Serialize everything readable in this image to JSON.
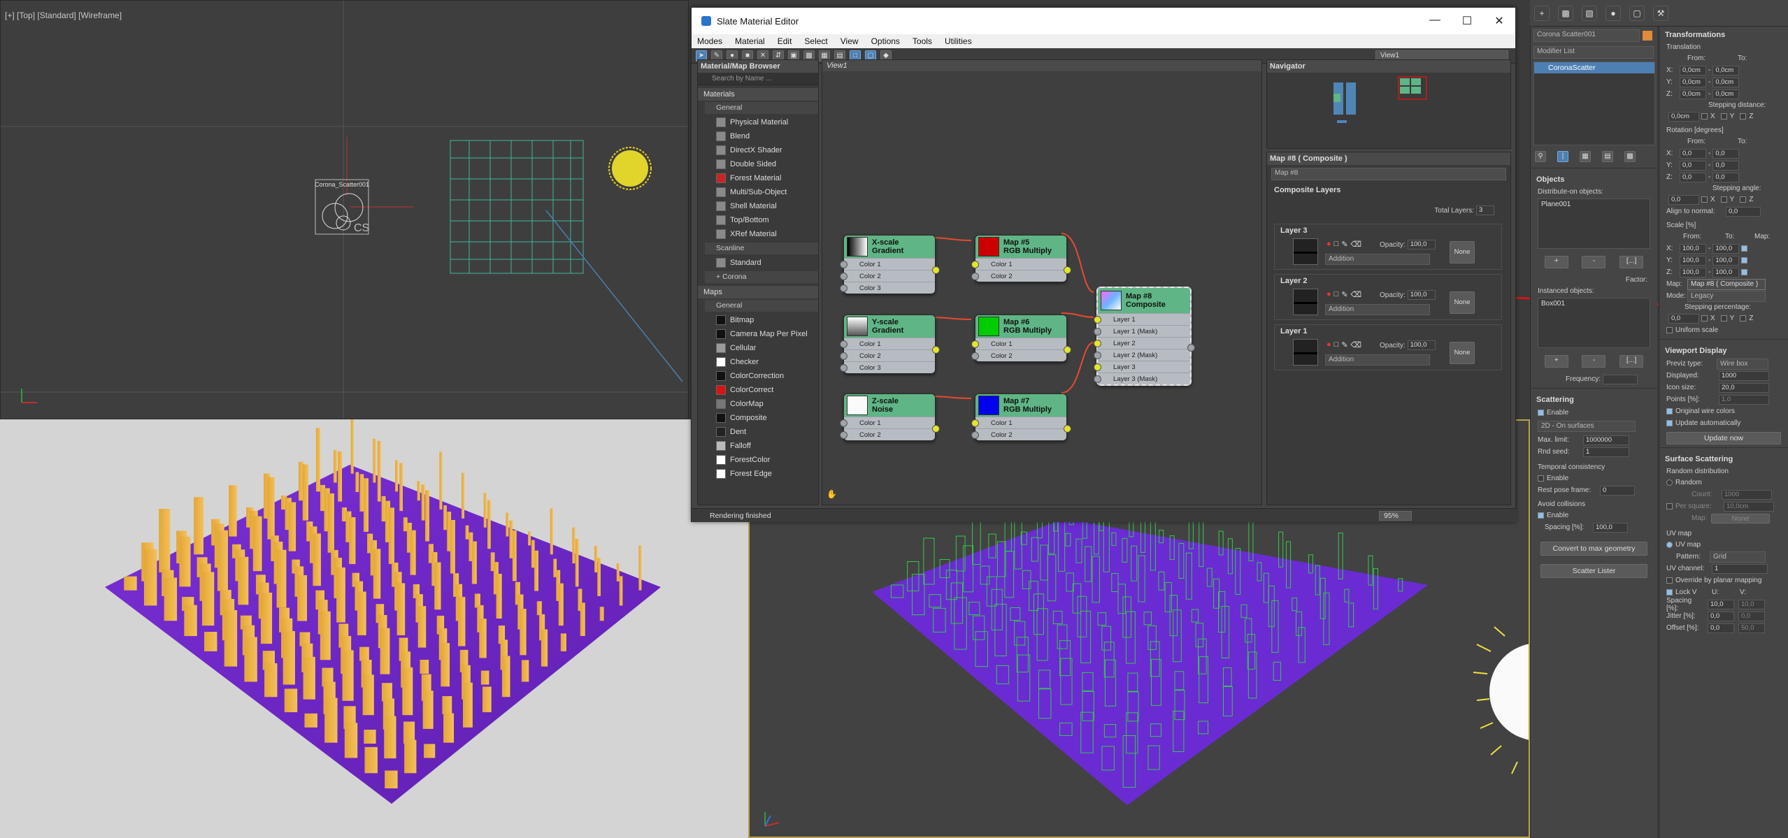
{
  "viewports": {
    "top_label": "[+] [Top] [Standard] [Wireframe]",
    "scatter_label": "Corona_Scatter001",
    "scatter_marker": "CS"
  },
  "slate": {
    "title": "Slate Material Editor",
    "menu": [
      "Modes",
      "Material",
      "Edit",
      "Select",
      "View",
      "Options",
      "Tools",
      "Utilities"
    ],
    "view_select": "View1",
    "view_tab": "View1",
    "browser": {
      "title": "Material/Map Browser",
      "search_placeholder": "Search by Name ...",
      "materials_group": "Materials",
      "general_sub": "General",
      "materials": [
        {
          "name": "Physical Material",
          "swatch": "#8a8a8a"
        },
        {
          "name": "Blend",
          "swatch": "#8a8a8a"
        },
        {
          "name": "DirectX Shader",
          "swatch": "#8a8a8a"
        },
        {
          "name": "Double Sided",
          "swatch": "#8a8a8a"
        },
        {
          "name": "Forest Material",
          "swatch": "#cc2222"
        },
        {
          "name": "Multi/Sub-Object",
          "swatch": "#8a8a8a"
        },
        {
          "name": "Shell Material",
          "swatch": "#8a8a8a"
        },
        {
          "name": "Top/Bottom",
          "swatch": "#8a8a8a"
        },
        {
          "name": "XRef Material",
          "swatch": "#8a8a8a"
        }
      ],
      "scanline_sub": "Scanline",
      "scanline_items": [
        {
          "name": "Standard",
          "swatch": "#8a8a8a"
        }
      ],
      "corona_sub": "+ Corona",
      "maps_group": "Maps",
      "maps_general_sub": "General",
      "maps": [
        {
          "name": "Bitmap",
          "swatch": "#111111"
        },
        {
          "name": "Camera Map Per Pixel",
          "swatch": "#111111"
        },
        {
          "name": "Cellular",
          "swatch": "#9a9a9a"
        },
        {
          "name": "Checker",
          "swatch": "#ffffff"
        },
        {
          "name": "ColorCorrection",
          "swatch": "#111111"
        },
        {
          "name": "ColorCorrect",
          "swatch": "#dd1111"
        },
        {
          "name": "ColorMap",
          "swatch": "#777777"
        },
        {
          "name": "Composite",
          "swatch": "#111111"
        },
        {
          "name": "Dent",
          "swatch": "#222222"
        },
        {
          "name": "Falloff",
          "swatch": "#bbbbbb"
        },
        {
          "name": "ForestColor",
          "swatch": "#ffffff"
        },
        {
          "name": "Forest Edge",
          "swatch": "#ffffff"
        }
      ]
    },
    "nodes": {
      "x_gradient": {
        "title1": "X-scale",
        "title2": "Gradient",
        "slots": [
          "Color 1",
          "Color 2",
          "Color 3"
        ]
      },
      "y_gradient": {
        "title1": "Y-scale",
        "title2": "Gradient",
        "slots": [
          "Color 1",
          "Color 2",
          "Color 3"
        ]
      },
      "z_noise": {
        "title1": "Z-scale",
        "title2": "Noise",
        "slots": [
          "Color 1",
          "Color 2"
        ]
      },
      "map5": {
        "title1": "Map #5",
        "title2": "RGB Multiply",
        "slots": [
          "Color 1",
          "Color 2"
        ],
        "color": "#cc0000"
      },
      "map6": {
        "title1": "Map #6",
        "title2": "RGB Multiply",
        "slots": [
          "Color 1",
          "Color 2"
        ],
        "color": "#00cc00"
      },
      "map7": {
        "title1": "Map #7",
        "title2": "RGB Multiply",
        "slots": [
          "Color 1",
          "Color 2"
        ],
        "color": "#0000ee"
      },
      "map8": {
        "title1": "Map #8",
        "title2": "Composite",
        "slots": [
          "Layer 1",
          "Layer 1 (Mask)",
          "Layer 2",
          "Layer 2 (Mask)",
          "Layer 3",
          "Layer 3 (Mask)"
        ]
      }
    },
    "navigator_title": "Navigator",
    "params": {
      "title": "Map #8  ( Composite )",
      "name_field": "Map #8",
      "section": "Composite Layers",
      "total_layers_label": "Total Layers:",
      "total_layers": "3",
      "opacity_label": "Opacity:",
      "layers": [
        {
          "name": "Layer 3",
          "opacity": "100,0",
          "mode": "Addition",
          "none": "None"
        },
        {
          "name": "Layer 2",
          "opacity": "100,0",
          "mode": "Addition",
          "none": "None"
        },
        {
          "name": "Layer 1",
          "opacity": "100,0",
          "mode": "Addition",
          "none": "None"
        }
      ]
    },
    "status": "Rendering finished",
    "zoom": "95%"
  },
  "command": {
    "object_name": "Corona Scatter001",
    "modifier_list": "Modifier List",
    "stack_item": "CoronaScatter",
    "objects_title": "Objects",
    "distribute_label": "Distribute-on objects:",
    "distribute_items": [
      "Plane001"
    ],
    "factor_label": "Factor:",
    "instanced_label": "Instanced objects:",
    "instanced_items": [
      "Box001"
    ],
    "frequency_label": "Frequency:",
    "scattering_title": "Scattering",
    "enable": "Enable",
    "mode_select": "2D - On surfaces",
    "max_limit_label": "Max. limit:",
    "max_limit": "1000000",
    "rnd_seed_label": "Rnd seed:",
    "rnd_seed": "1",
    "temporal_label": "Temporal consistency",
    "rest_pose_label": "Rest pose frame:",
    "rest_pose": "0",
    "avoid_label": "Avoid collisions",
    "spacing_label": "Spacing [%]:",
    "spacing": "100,0",
    "convert_btn": "Convert to max geometry",
    "lister_btn": "Scatter Lister"
  },
  "rollout": {
    "transformations": "Transformations",
    "translation": "Translation",
    "from": "From:",
    "to": "To:",
    "axes": [
      "X:",
      "Y:",
      "Z:"
    ],
    "zero_cm": "0,0cm",
    "stepping_distance": "Stepping distance:",
    "rotation": "Rotation [degrees]",
    "zero": "0,0",
    "stepping_angle": "Stepping angle:",
    "align_normal": "Align to normal:",
    "scale": "Scale [%]",
    "map_col": "Map:",
    "hundred": "100,0",
    "map_label": "Map:",
    "map_value": "Map #8  ( Composite )",
    "mode_label": "Mode:",
    "mode_value": "Legacy",
    "stepping_pct": "Stepping percentage:",
    "uniform_scale": "Uniform scale",
    "viewport_display": "Viewport Display",
    "previz_label": "Previz type:",
    "previz_value": "Wire box",
    "displayed_label": "Displayed:",
    "displayed_value": "1000",
    "icon_size_label": "Icon size:",
    "icon_size_value": "20,0",
    "points_label": "Points [%]:",
    "points_value": "1,0",
    "orig_wire": "Original wire colors",
    "update_auto": "Update automatically",
    "update_now": "Update now",
    "surface_scattering": "Surface Scattering",
    "random_dist": "Random distribution",
    "random": "Random",
    "count_label": "Count:",
    "count_value": "1000",
    "per_square_label": "Per square:",
    "per_square_value": "10,0cm",
    "map_none": "None",
    "uv_map_title": "UV map",
    "uv_map": "UV map",
    "pattern_label": "Pattern:",
    "pattern_value": "Grid",
    "uv_channel_label": "UV channel:",
    "uv_channel_value": "1",
    "override_planar": "Override by planar mapping",
    "lock_v": "Lock V",
    "u_label": "U:",
    "v_label": "V:",
    "spacing_label": "Spacing [%]:",
    "jitter_label": "Jitter [%]:",
    "offset_label": "Offset [%]:",
    "spacing_u": "10,0",
    "spacing_v": "10,0",
    "jitter_u": "0,0",
    "jitter_v": "0,0",
    "offset_u": "0,0",
    "offset_v": "50,0"
  }
}
